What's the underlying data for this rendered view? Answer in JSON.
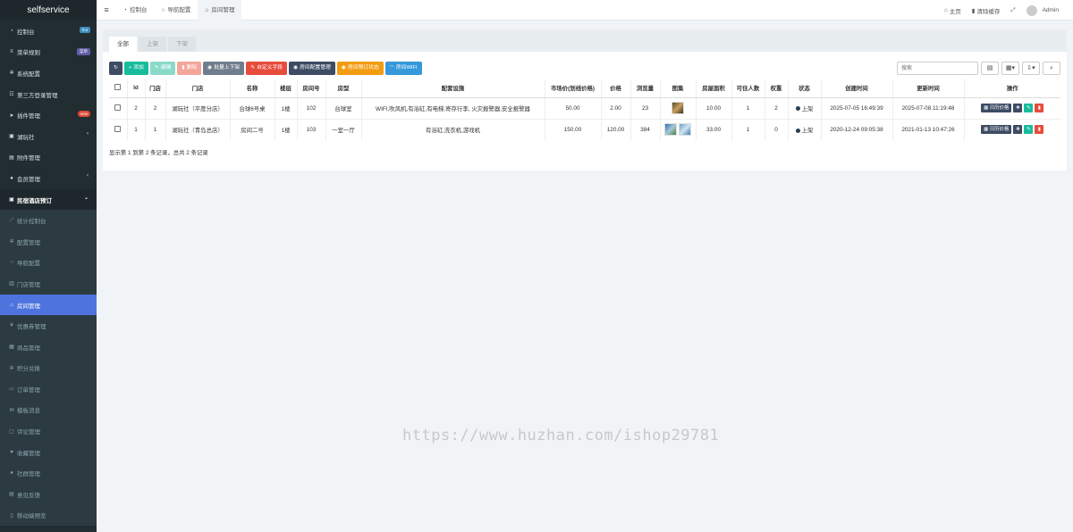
{
  "app": {
    "brand": "selfservice"
  },
  "sidebar": {
    "items": [
      {
        "label": "控制台",
        "icon": "dashboard-icon",
        "badge": "hot"
      },
      {
        "label": "菜单规则",
        "icon": "bars-icon",
        "badge": "菜单"
      },
      {
        "label": "系统配置",
        "icon": "cog-icon"
      },
      {
        "label": "第三方登录管理",
        "icon": "users-icon"
      },
      {
        "label": "插件管理",
        "icon": "rocket-icon",
        "badge": "new"
      },
      {
        "label": "湖玩社",
        "icon": "list-icon"
      },
      {
        "label": "附件管理",
        "icon": "file-image-icon"
      },
      {
        "label": "会员管理",
        "icon": "user-icon"
      },
      {
        "label": "民宿酒店预订",
        "icon": "list-icon"
      },
      {
        "label": "统计控制台",
        "icon": "chart-icon"
      },
      {
        "label": "配置管理",
        "icon": "cog-icon"
      },
      {
        "label": "导航配置",
        "icon": "nav-icon"
      },
      {
        "label": "门店管理",
        "icon": "bank-icon"
      },
      {
        "label": "房间管理",
        "icon": "home-icon"
      },
      {
        "label": "优惠券管理",
        "icon": "yen-icon"
      },
      {
        "label": "商品管理",
        "icon": "shop-icon"
      },
      {
        "label": "积分兑换",
        "icon": "points-icon"
      },
      {
        "label": "订单管理",
        "icon": "order-icon"
      },
      {
        "label": "模板消息",
        "icon": "envelope-icon"
      },
      {
        "label": "评论管理",
        "icon": "comment-icon"
      },
      {
        "label": "收藏管理",
        "icon": "heart-icon"
      },
      {
        "label": "社群管理",
        "icon": "group-icon"
      },
      {
        "label": "意见反馈",
        "icon": "feedback-icon"
      },
      {
        "label": "移动端预览",
        "icon": "mobile-icon"
      }
    ]
  },
  "topbar": {
    "tabs": [
      {
        "label": "控制台",
        "icon": "dashboard-icon"
      },
      {
        "label": "导航配置",
        "icon": "nav-icon"
      },
      {
        "label": "房间管理",
        "icon": "home-icon"
      }
    ],
    "home": "主页",
    "clear_cache": "清除缓存",
    "user": "Admin"
  },
  "panel": {
    "tabs": [
      "全部",
      "上架",
      "下架"
    ],
    "toolbar": {
      "add": "添加",
      "edit": "编辑",
      "delete": "删除",
      "batch": "批量上下架",
      "custom": "自定义字段",
      "room_facility": "房间配置管理",
      "room_booking": "房间预订状态",
      "room_wifi": "房间WIFI"
    },
    "search_placeholder": "搜索",
    "table": {
      "headers": [
        "Id",
        "门店",
        "门店",
        "名称",
        "楼层",
        "房间号",
        "房型",
        "配套设施",
        "市场价(划线价格)",
        "价格",
        "浏览量",
        "图集",
        "房屋面积",
        "可住人数",
        "权重",
        "状态",
        "创建时间",
        "更新时间",
        "操作"
      ],
      "rows": [
        {
          "id": "2",
          "store_id": "2",
          "store": "湖玩社（平度分店）",
          "name": "台球6号桌",
          "floor": "1楼",
          "room_no": "102",
          "type": "台球室",
          "facilities": "WIFI,吹风机,有浴缸,有电梯,寄存行李, 火灾报警器,安全报警器",
          "market_price": "50.00",
          "price": "2.00",
          "views": "23",
          "area": "10.00",
          "capacity": "1",
          "weight": "2",
          "status": "上架",
          "created": "2025-07-05 16:49:39",
          "updated": "2025-07-08 11:19:48",
          "calendar": "日历价格"
        },
        {
          "id": "1",
          "store_id": "1",
          "store": "湖玩社（青岛总店）",
          "name": "房间二号",
          "floor": "1楼",
          "room_no": "103",
          "type": "一室一厅",
          "facilities": "有浴缸,洗衣机,游戏机",
          "market_price": "150.00",
          "price": "120.00",
          "views": "384",
          "area": "33.00",
          "capacity": "1",
          "weight": "0",
          "status": "上架",
          "created": "2020-12-24 09:05:38",
          "updated": "2021-01-13 10:47:26",
          "calendar": "日历价格"
        }
      ]
    },
    "footer": "显示第 1 到第 2 条记录，总共 2 条记录"
  },
  "watermark": "https://www.huzhan.com/ishop29781"
}
